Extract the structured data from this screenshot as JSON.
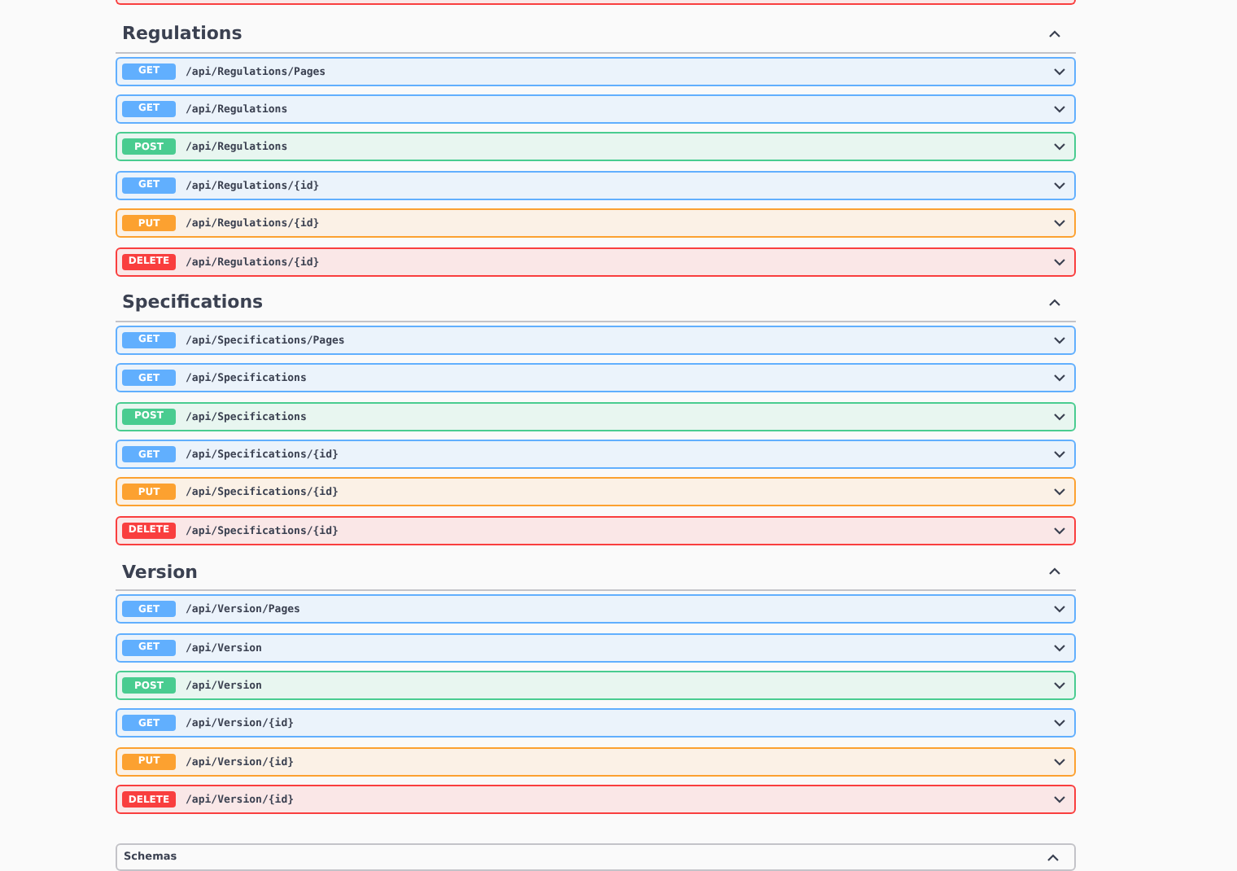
{
  "partial_row": {
    "kind": "delete"
  },
  "sections": [
    {
      "title": "Regulations",
      "expanded": true,
      "operations": [
        {
          "method": "GET",
          "kind": "get",
          "path": "/api/Regulations/Pages"
        },
        {
          "method": "GET",
          "kind": "get",
          "path": "/api/Regulations"
        },
        {
          "method": "POST",
          "kind": "post",
          "path": "/api/Regulations"
        },
        {
          "method": "GET",
          "kind": "get",
          "path": "/api/Regulations/{id}"
        },
        {
          "method": "PUT",
          "kind": "put",
          "path": "/api/Regulations/{id}"
        },
        {
          "method": "DELETE",
          "kind": "delete",
          "path": "/api/Regulations/{id}"
        }
      ]
    },
    {
      "title": "Specifications",
      "expanded": true,
      "operations": [
        {
          "method": "GET",
          "kind": "get",
          "path": "/api/Specifications/Pages"
        },
        {
          "method": "GET",
          "kind": "get",
          "path": "/api/Specifications"
        },
        {
          "method": "POST",
          "kind": "post",
          "path": "/api/Specifications"
        },
        {
          "method": "GET",
          "kind": "get",
          "path": "/api/Specifications/{id}"
        },
        {
          "method": "PUT",
          "kind": "put",
          "path": "/api/Specifications/{id}"
        },
        {
          "method": "DELETE",
          "kind": "delete",
          "path": "/api/Specifications/{id}"
        }
      ]
    },
    {
      "title": "Version",
      "expanded": true,
      "operations": [
        {
          "method": "GET",
          "kind": "get",
          "path": "/api/Version/Pages"
        },
        {
          "method": "GET",
          "kind": "get",
          "path": "/api/Version"
        },
        {
          "method": "POST",
          "kind": "post",
          "path": "/api/Version"
        },
        {
          "method": "GET",
          "kind": "get",
          "path": "/api/Version/{id}"
        },
        {
          "method": "PUT",
          "kind": "put",
          "path": "/api/Version/{id}"
        },
        {
          "method": "DELETE",
          "kind": "delete",
          "path": "/api/Version/{id}"
        }
      ]
    }
  ],
  "schemas": {
    "title": "Schemas",
    "expanded": true
  }
}
